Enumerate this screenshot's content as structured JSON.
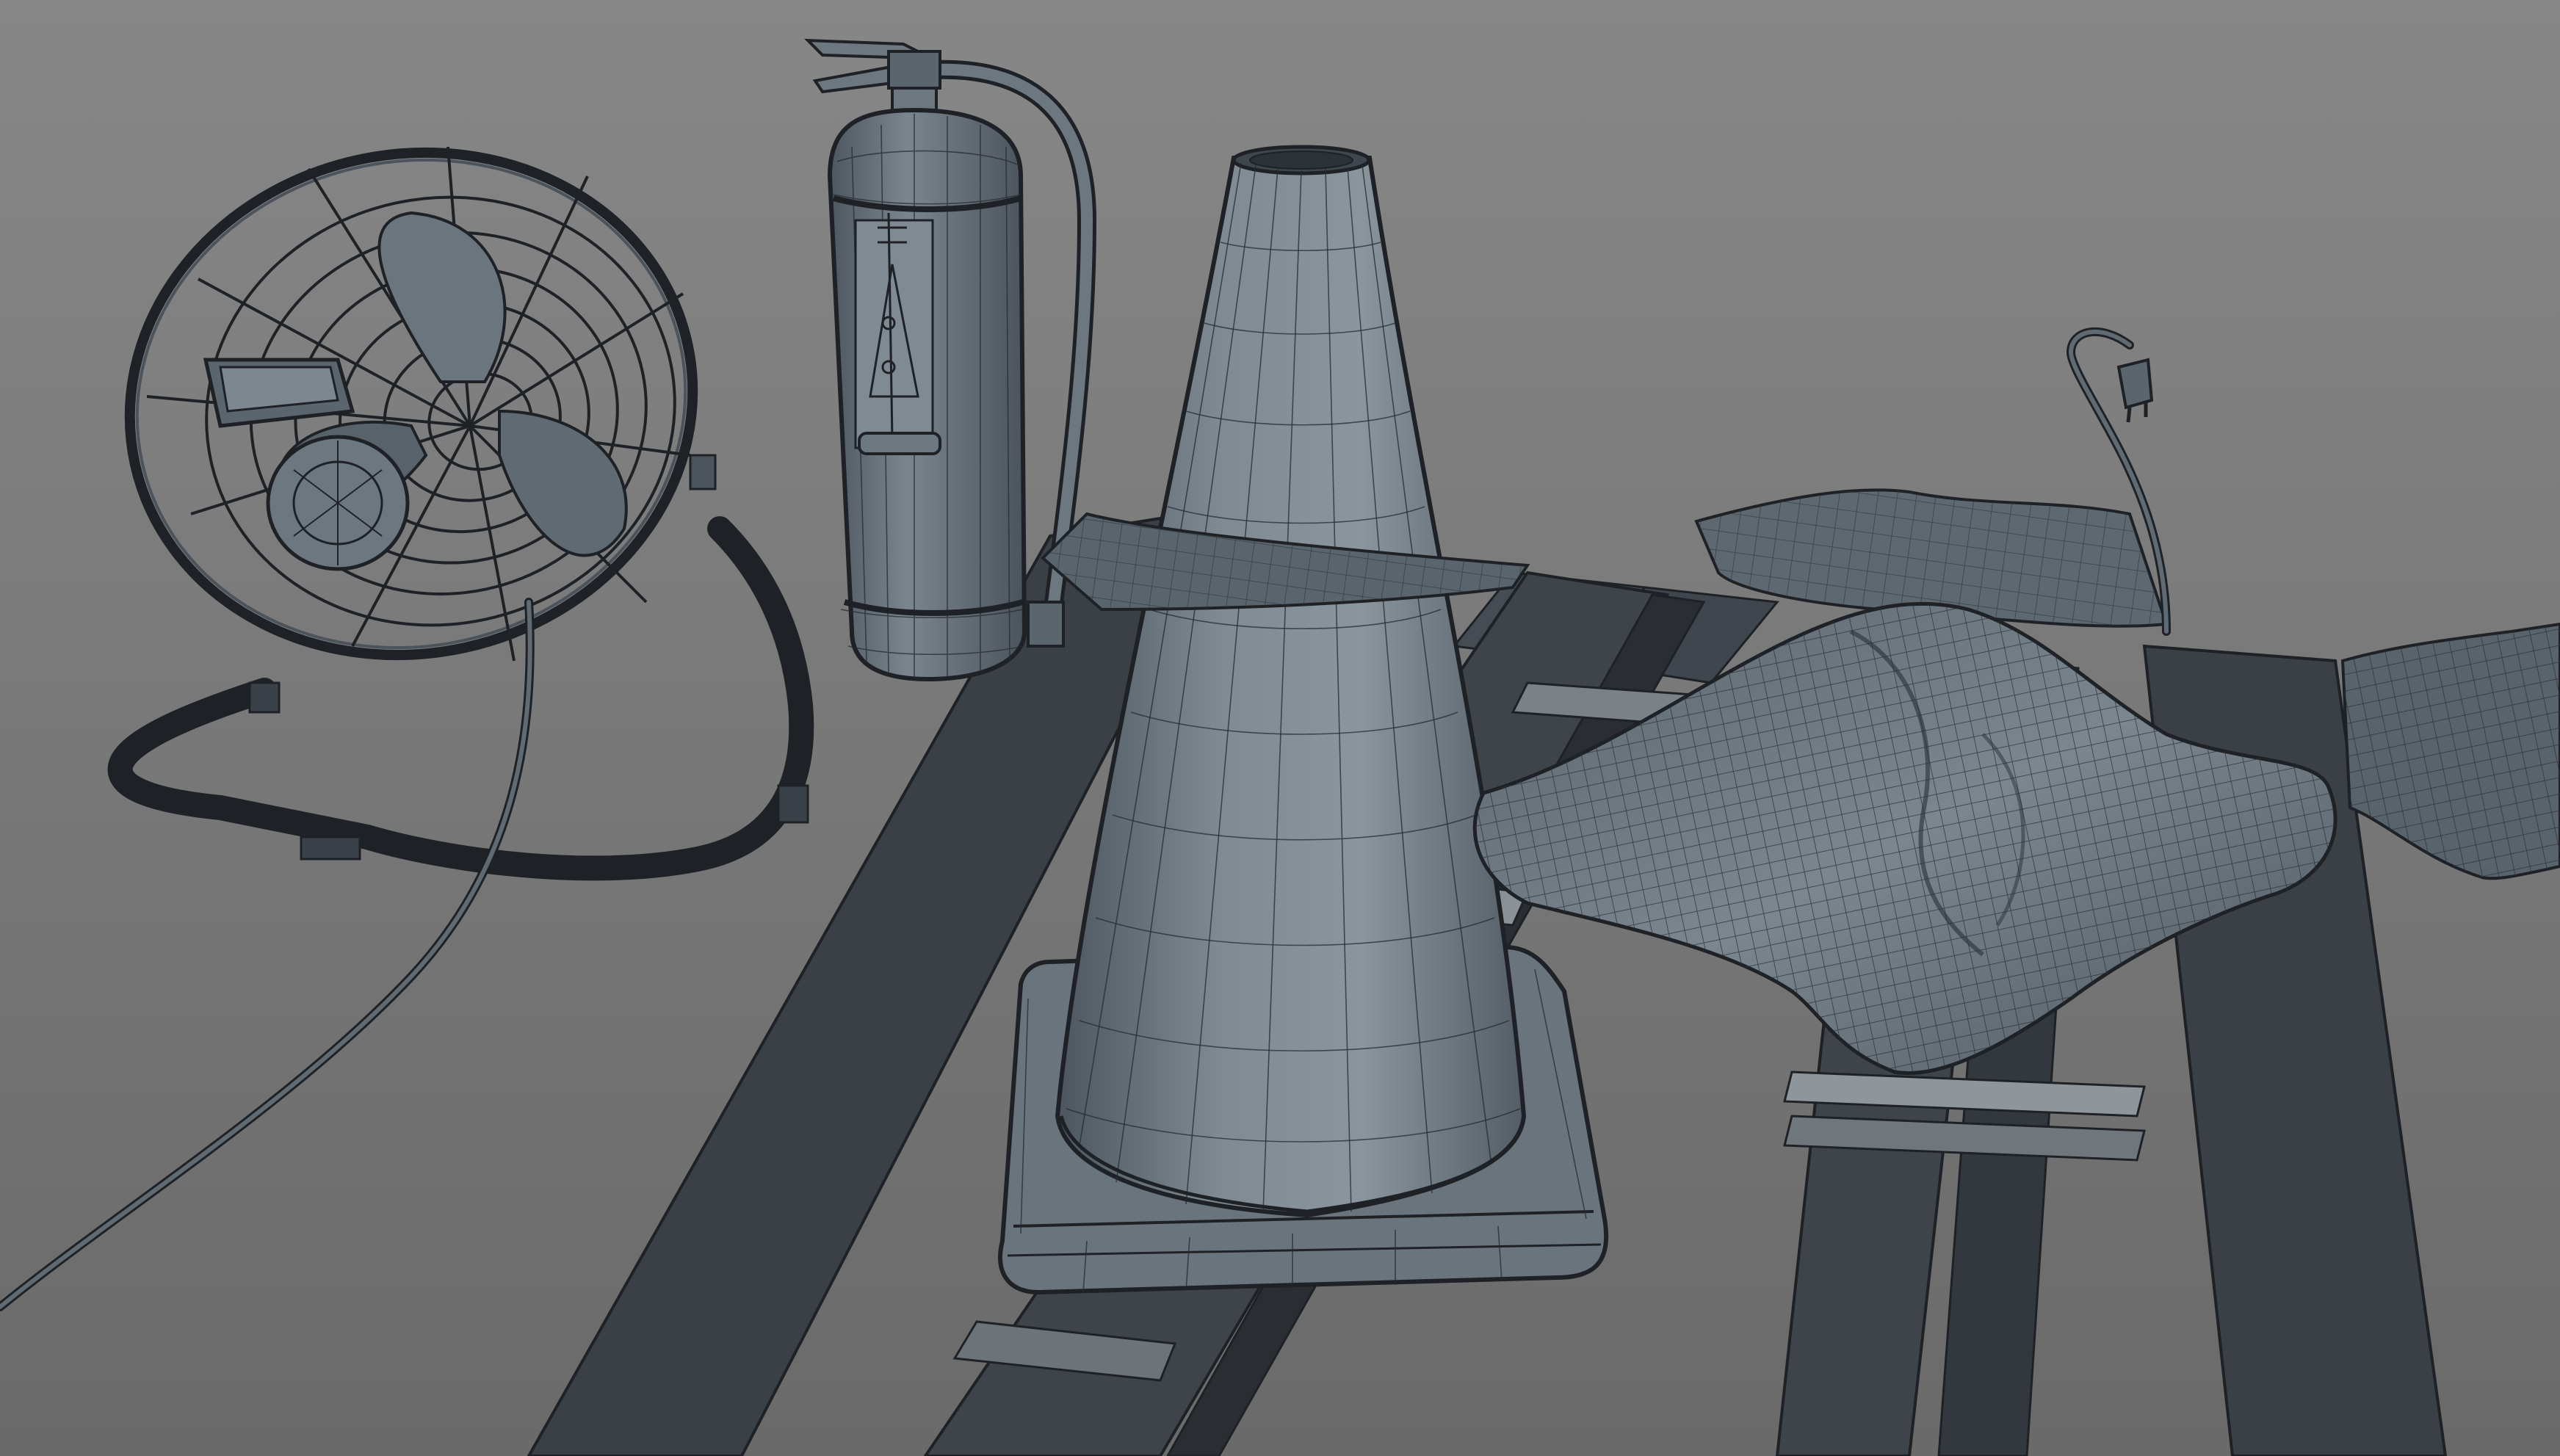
{
  "viewport": {
    "background_top": "#858585",
    "background_bottom": "#6c6c6c",
    "display_mode": "wireframe-on-shaded"
  },
  "scene": {
    "objects": [
      {
        "name": "desk-fan",
        "icon": "fan-icon"
      },
      {
        "name": "fire-extinguisher",
        "icon": "fire-extinguisher-icon"
      },
      {
        "name": "traffic-cone",
        "icon": "cone-icon"
      },
      {
        "name": "cloth",
        "icon": "cloth-icon"
      },
      {
        "name": "power-cable-plug",
        "icon": "plug-icon"
      },
      {
        "name": "wooden-pallet",
        "icon": "pallet-icon"
      }
    ],
    "colors": {
      "mesh_shaded": "#5f6a74",
      "mesh_light": "#8e98a0",
      "mesh_dark": "#3a4148",
      "wireframe": "#1e2226",
      "pallet": "#3b4046"
    }
  }
}
